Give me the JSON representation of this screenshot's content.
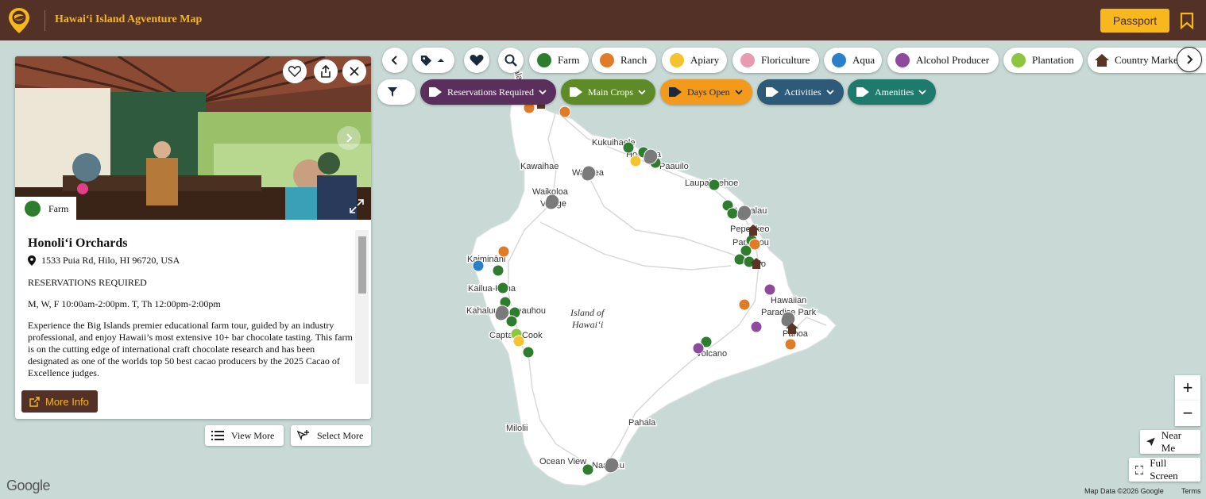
{
  "header": {
    "title": "Hawaiʻi Island Agventure Map",
    "passport_label": "Passport"
  },
  "categories": [
    {
      "label": "Farm",
      "color": "#2e7d2e"
    },
    {
      "label": "Ranch",
      "color": "#e07b28"
    },
    {
      "label": "Apiary",
      "color": "#f4c430"
    },
    {
      "label": "Floriculture",
      "color": "#e89ab0"
    },
    {
      "label": "Aqua",
      "color": "#2a7fc9"
    },
    {
      "label": "Alcohol Producer",
      "color": "#8e4a9c"
    },
    {
      "label": "Plantation",
      "color": "#8cc63f"
    },
    {
      "label": "Country Market",
      "color": "#5a3424"
    }
  ],
  "filters": [
    {
      "label": "Reservations Required",
      "color": "#5a2f5e"
    },
    {
      "label": "Main Crops",
      "color": "#5e8a27"
    },
    {
      "label": "Days Open",
      "color": "#f39a1c"
    },
    {
      "label": "Activities",
      "color": "#2d5a78"
    },
    {
      "label": "Amenities",
      "color": "#1f7a6e"
    }
  ],
  "card": {
    "category": "Farm",
    "name": "Honoliʻi Orchards",
    "address": "1533 Puia Rd, Hilo, HI 96720, USA",
    "reservations": "RESERVATIONS REQUIRED",
    "hours": "M, W, F 10:00am-2:00pm. T, Th 12:00pm-2:00pm",
    "description": "Experience the Big Islands premier educational farm tour, guided by an industry professional, and enjoy Hawaii’s most extensive 10+ bar chocolate tasting. This farm is on the cutting edge of international craft chocolate research and has been designated as one of the worlds top 50 best cacao producers by the 2025 Cacao of Excellence judges.",
    "more_info_label": "More Info"
  },
  "panel_buttons": {
    "view_more": "View More",
    "select_more": "Select More"
  },
  "map": {
    "island_label_1": "Island of",
    "island_label_2": "Hawaiʻi",
    "places": [
      "Kukuihaele",
      "Honokaa",
      "Paauilo",
      "Kawaihae",
      "Waimea",
      "Waikoloa",
      "Village",
      "Laupahoehoe",
      "Hakalau",
      "Pepeekeo",
      "Papaikou",
      "Hilo",
      "Kaimināni",
      "Kailua-Kona",
      "Kahaluu",
      "Keauhou",
      "Captain Cook",
      "Hawaiian",
      "Paradise Park",
      "Pahoa",
      "Volcano",
      "Pahala",
      "Milolii",
      "Ocean View",
      "Naalehu"
    ],
    "near_me_label": "Near Me",
    "full_screen_label": "Full Screen",
    "zoom_in": "+",
    "zoom_out": "−",
    "google_label": "Google",
    "attribution": "Map Data ©2026 Google",
    "terms": "Terms"
  }
}
